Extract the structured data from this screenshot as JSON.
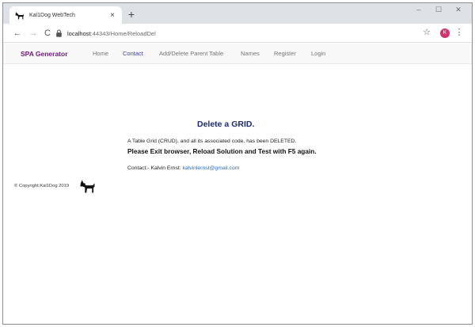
{
  "browser": {
    "tab_title": "Kal1Dog WebTech",
    "tab_close": "×",
    "new_tab": "+",
    "window_controls": {
      "minimize": "–",
      "maximize": "☐",
      "close": "✕"
    },
    "nav": {
      "back": "←",
      "forward": "→",
      "reload": "C"
    },
    "url_host": "localhost",
    "url_path": ":44343/Home/ReloadDel",
    "bookmark": "☆",
    "profile_initial": "K",
    "menu": "⋮"
  },
  "navbar": {
    "brand": "SPA Generator",
    "links": [
      "Home",
      "Contact",
      "Add/Delete Parent Table",
      "Names",
      "Register",
      "Login"
    ],
    "active_index": 1
  },
  "content": {
    "heading": "Delete a GRID.",
    "line1": "A Table Grid (CRUD), and all its associated code, has been DELETED.",
    "line2": "Please Exit browser, Reload Solution and Test with F5 again.",
    "contact_label": "Contact:- Kalvin Ernst:",
    "contact_email": "kalvinlernst@gmail.com"
  },
  "footer": {
    "copyright": "© Copyright Kal1Dog 2019"
  },
  "colors": {
    "brand": "#6a1b7a",
    "active_link": "#3b3bbf",
    "heading": "#1d2b73",
    "link": "#2b6fb5",
    "avatar": "#d62f6a"
  },
  "icons": [
    "dog-icon",
    "lock-icon",
    "star-icon",
    "menu-icon"
  ]
}
